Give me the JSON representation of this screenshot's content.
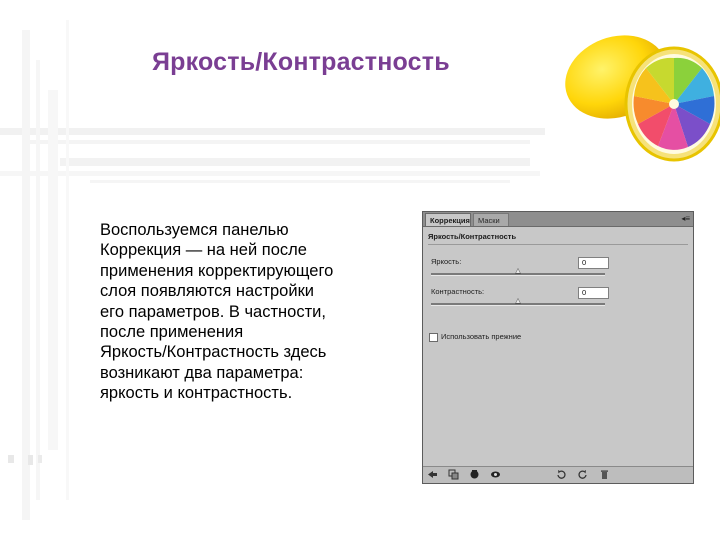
{
  "slide": {
    "title": "Яркость/Контрастность",
    "body_lines": [
      "Воспользуемся панелью",
      "Коррекция — на ней после",
      "применения корректирующего",
      "слоя появляются настройки",
      "его параметров. В частности,",
      "после применения",
      "Яркость/Контрастность здесь",
      "возникают два параметра:",
      "яркость и контрастность."
    ]
  },
  "panel": {
    "tabs": [
      "Коррекция",
      "Маски"
    ],
    "menu_glyph": "◂≡",
    "heading": "Яркость/Контрастность",
    "params": [
      {
        "label": "Яркость:",
        "value": "0",
        "level": 0.5
      },
      {
        "label": "Контрастность:",
        "value": "0",
        "level": 0.5
      }
    ],
    "checkbox_label": "Использовать прежние",
    "bottom_icons": [
      "back-icon",
      "clip-icon",
      "visibility-icon",
      "eye-icon",
      "reset-icon",
      "reset-alt-icon",
      "delete-icon"
    ]
  },
  "colors": {
    "title": "#7a3e93",
    "panel_bg": "#c8c8c8",
    "tab_bar": "#8e8e8e"
  }
}
